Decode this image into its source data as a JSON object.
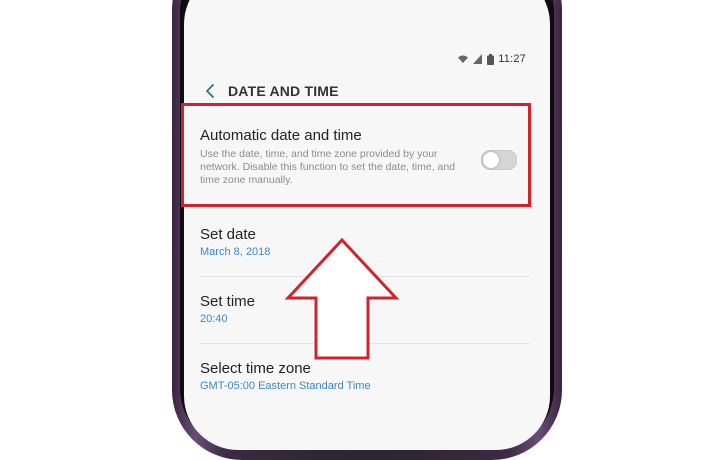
{
  "status_bar": {
    "time": "11:27"
  },
  "header": {
    "title": "DATE AND TIME"
  },
  "settings": {
    "automatic": {
      "title": "Automatic date and time",
      "description": "Use the date, time, and time zone provided by your network. Disable this function to set the date, time, and time zone manually.",
      "enabled": false
    },
    "set_date": {
      "title": "Set date",
      "value": "March 8, 2018"
    },
    "set_time": {
      "title": "Set time",
      "value": "20:40"
    },
    "time_zone": {
      "title": "Select time zone",
      "value": "GMT-05:00 Eastern Standard Time"
    }
  },
  "colors": {
    "accent_value": "#3c88c4",
    "highlight": "#d0242c",
    "phone_frame": "#3b2a42"
  },
  "icons": [
    "back-arrow-icon",
    "wifi-icon",
    "signal-icon",
    "battery-icon",
    "pointer-arrow-icon"
  ]
}
